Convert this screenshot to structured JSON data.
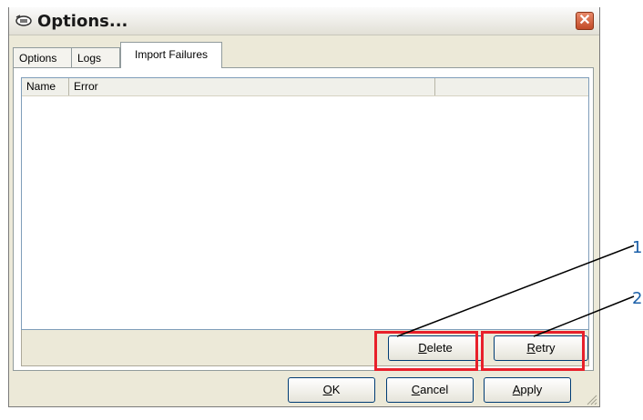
{
  "window": {
    "title": "Options...",
    "close_symbol": "✕",
    "title_icon": "options-icon"
  },
  "tabs": [
    {
      "label": "Options",
      "active": false
    },
    {
      "label": "Logs",
      "active": false
    },
    {
      "label": "Import Failures",
      "active": true
    }
  ],
  "list": {
    "columns": [
      "Name",
      "Error",
      ""
    ],
    "rows": []
  },
  "actions": {
    "delete": {
      "prefix": "",
      "mnemonic": "D",
      "rest": "elete"
    },
    "retry": {
      "prefix": "",
      "mnemonic": "R",
      "rest": "etry"
    }
  },
  "footer": {
    "ok": {
      "mnemonic": "O",
      "rest": "K"
    },
    "cancel": {
      "mnemonic": "C",
      "rest": "ancel"
    },
    "apply": {
      "mnemonic": "A",
      "rest": "pply"
    }
  },
  "callouts": [
    "1",
    "2"
  ],
  "colors": {
    "highlight": "#e8202a",
    "callout_text": "#1a5fa8"
  }
}
